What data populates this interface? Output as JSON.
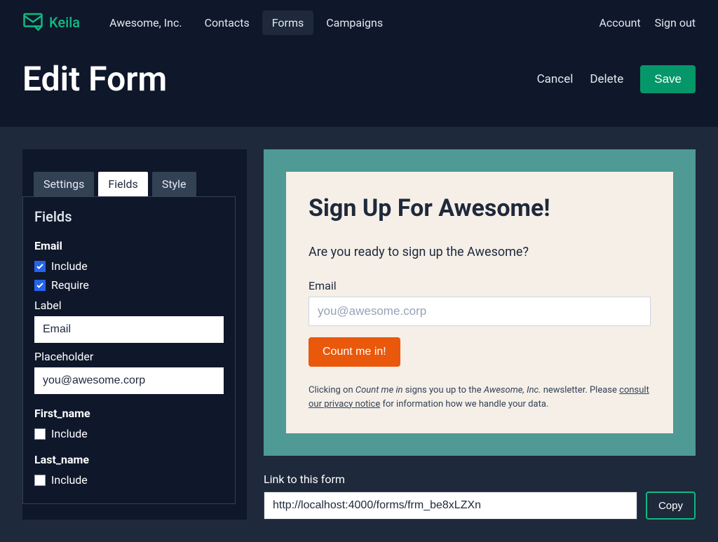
{
  "brand": "Keila",
  "nav": {
    "items": [
      "Awesome, Inc.",
      "Contacts",
      "Forms",
      "Campaigns"
    ],
    "active": 2,
    "right": [
      "Account",
      "Sign out"
    ]
  },
  "header": {
    "title": "Edit Form",
    "cancel": "Cancel",
    "delete": "Delete",
    "save": "Save"
  },
  "tabs": [
    "Settings",
    "Fields",
    "Style"
  ],
  "activeTab": 1,
  "panel": {
    "title": "Fields",
    "email": {
      "name": "Email",
      "include": "Include",
      "require": "Require",
      "labelLabel": "Label",
      "labelValue": "Email",
      "placeholderLabel": "Placeholder",
      "placeholderValue": "you@awesome.corp"
    },
    "first": {
      "name": "First_name",
      "include": "Include"
    },
    "last": {
      "name": "Last_name",
      "include": "Include"
    }
  },
  "preview": {
    "title": "Sign Up For Awesome!",
    "intro": "Are you ready to sign up the Awesome?",
    "emailLabel": "Email",
    "emailPlaceholder": "you@awesome.corp",
    "submit": "Count me in!",
    "fine1": "Clicking on ",
    "fineItalic1": "Count me in",
    "fine2": " signs you up to the ",
    "fineItalic2": "Awesome, Inc.",
    "fine3": " newsletter. Please ",
    "fineLink": "consult our privacy notice",
    "fine4": " for information how we handle your data."
  },
  "linkSection": {
    "label": "Link to this form",
    "url": "http://localhost:4000/forms/frm_be8xLZXn",
    "copy": "Copy"
  }
}
